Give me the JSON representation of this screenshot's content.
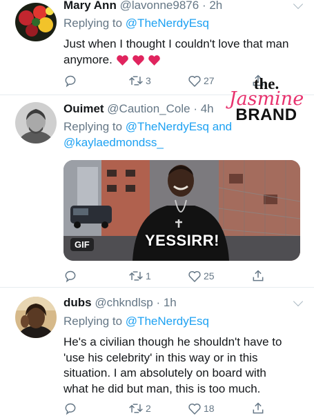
{
  "watermark": {
    "the": "the.",
    "jasmine": "Jasmine",
    "brand": "BRAND"
  },
  "tweets": [
    {
      "name": "Mary Ann",
      "handle": "@lavonne9876",
      "time": "· 2h",
      "replying_prefix": "Replying to",
      "replying_to": "@TheNerdyEsq",
      "body": "Just when I thought I couldn't love that man anymore.",
      "emoji_count": 3,
      "retweets": "3",
      "likes": "27"
    },
    {
      "name": "Ouimet",
      "handle": "@Caution_Cole",
      "time": "· 4h",
      "replying_prefix": "Replying to",
      "replying_to": "@TheNerdyEsq",
      "replying_and": "and",
      "replying_to_2": "@kaylaedmondss_",
      "gif_badge": "GIF",
      "gif_caption": "YESSIRR!",
      "retweets": "1",
      "likes": "25"
    },
    {
      "name": "dubs",
      "handle": "@chkndlsp",
      "time": "· 1h",
      "replying_prefix": "Replying to",
      "replying_to": "@TheNerdyEsq",
      "body": "He's a civilian though he shouldn't have to 'use his celebrity' in this way or in this situation. I am absolutely on board with what he did but man, this is too much.",
      "retweets": "2",
      "likes": "18"
    }
  ],
  "colors": {
    "link": "#1da1f2",
    "muted": "#657786",
    "heart_emoji": "#e0245e",
    "watermark_pink": "#e8326e"
  },
  "icons": [
    "reply-icon",
    "retweet-icon",
    "like-icon",
    "share-icon",
    "chevron-down-icon"
  ]
}
